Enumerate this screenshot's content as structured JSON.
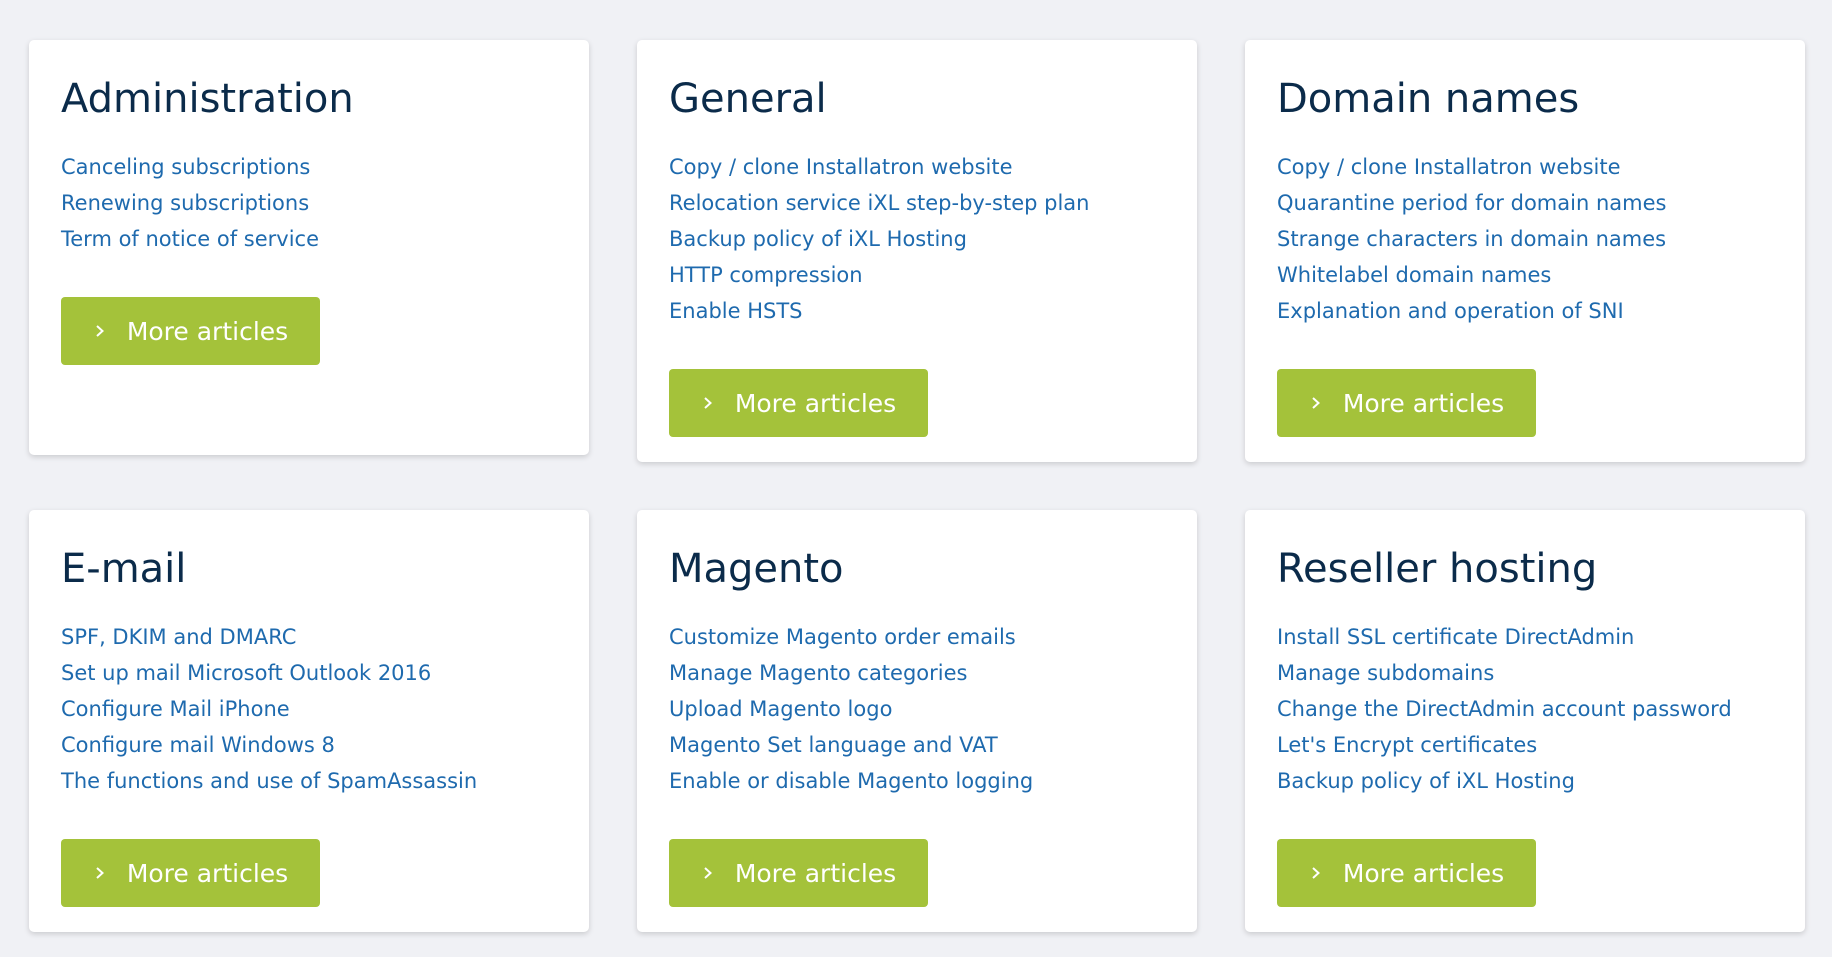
{
  "colors": {
    "page_bg": "#f0f1f5",
    "card_bg": "#ffffff",
    "title": "#0b2b4a",
    "link": "#1e6aae",
    "button_bg": "#a4c23a",
    "button_text": "#ffffff"
  },
  "icons": {
    "button_icon": "chevron-right-icon"
  },
  "cards": [
    {
      "title": "Administration",
      "links": [
        "Canceling subscriptions",
        "Renewing subscriptions",
        "Term of notice of service"
      ],
      "button_label": "More articles"
    },
    {
      "title": "General",
      "links": [
        "Copy / clone Installatron website",
        "Relocation service iXL step-by-step plan",
        "Backup policy of iXL Hosting",
        "HTTP compression",
        "Enable HSTS"
      ],
      "button_label": "More articles"
    },
    {
      "title": "Domain names",
      "links": [
        "Copy / clone Installatron website",
        "Quarantine period for domain names",
        "Strange characters in domain names",
        "Whitelabel domain names",
        "Explanation and operation of SNI"
      ],
      "button_label": "More articles"
    },
    {
      "title": "E-mail",
      "links": [
        "SPF, DKIM and DMARC",
        "Set up mail Microsoft Outlook 2016",
        "Configure Mail iPhone",
        "Configure mail Windows 8",
        "The functions and use of SpamAssassin"
      ],
      "button_label": "More articles"
    },
    {
      "title": "Magento",
      "links": [
        "Customize Magento order emails",
        "Manage Magento categories",
        "Upload Magento logo",
        "Magento Set language and VAT",
        "Enable or disable Magento logging"
      ],
      "button_label": "More articles"
    },
    {
      "title": "Reseller hosting",
      "links": [
        "Install SSL certificate DirectAdmin",
        "Manage subdomains",
        "Change the DirectAdmin account password",
        "Let's Encrypt certificates",
        "Backup policy of iXL Hosting"
      ],
      "button_label": "More articles"
    }
  ]
}
